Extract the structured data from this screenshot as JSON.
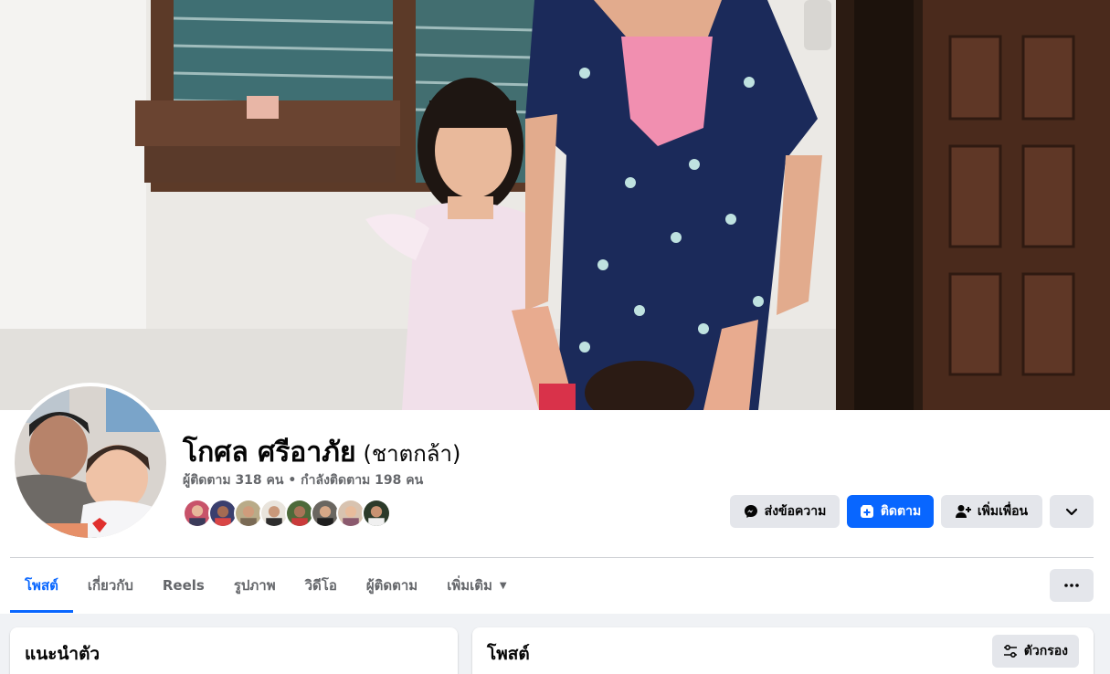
{
  "profile": {
    "name": "โกศล ศรีอาภัย",
    "alternate_name": "(ชาตกล้า)",
    "counts": "ผู้ติดตาม 318 คน • กำลังติดตาม 198 คน"
  },
  "actions": {
    "message_label": "ส่งข้อความ",
    "follow_label": "ติดตาม",
    "add_friend_label": "เพิ่มเพื่อน"
  },
  "tabs": [
    {
      "label": "โพสต์"
    },
    {
      "label": "เกี่ยวกับ"
    },
    {
      "label": "Reels"
    },
    {
      "label": "รูปภาพ"
    },
    {
      "label": "วิดีโอ"
    },
    {
      "label": "ผู้ติดตาม"
    },
    {
      "label": "เพิ่มเติม"
    }
  ],
  "intro_card": {
    "title": "แนะนำตัว"
  },
  "posts_card": {
    "title": "โพสต์",
    "filter_label": "ตัวกรอง"
  },
  "icons": {
    "message": "messenger-icon",
    "follow": "follow-icon",
    "add_friend": "add-friend-icon",
    "dropdown": "chevron-down-icon",
    "more": "more-dots-icon",
    "filter": "filter-icon"
  },
  "colors": {
    "accent": "#0866ff",
    "button_gray": "#e4e6eb",
    "muted_text": "#65676b"
  }
}
